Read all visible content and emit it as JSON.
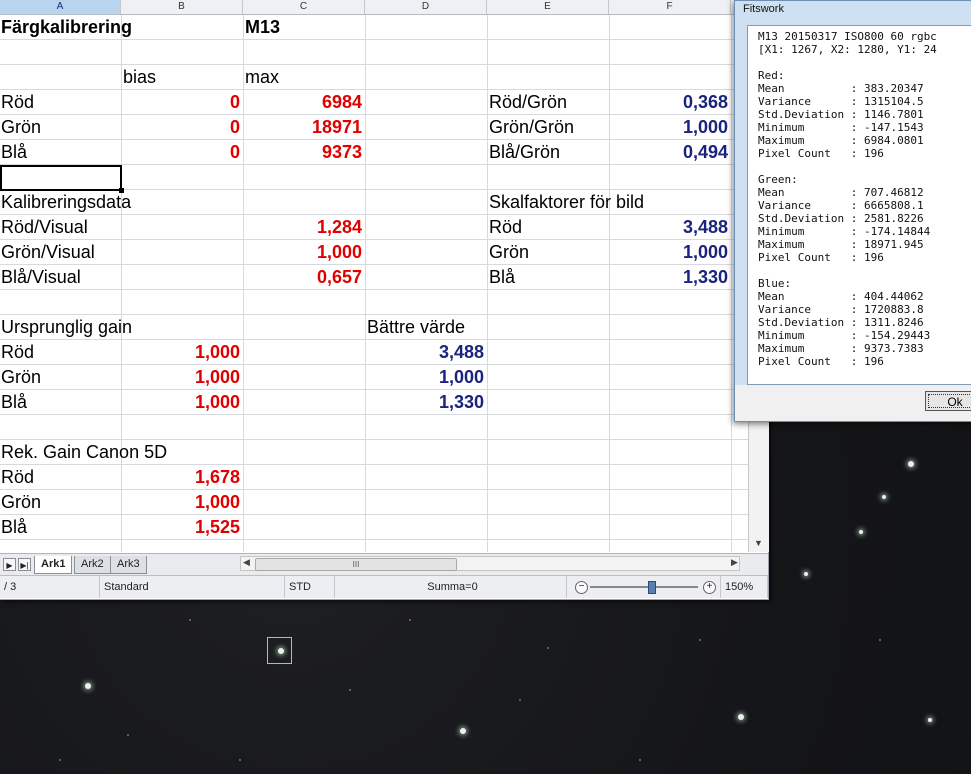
{
  "columns": [
    "A",
    "B",
    "C",
    "D",
    "E",
    "F"
  ],
  "cells": {
    "title": "Färgkalibrering",
    "object": "M13",
    "bias_hdr": "bias",
    "max_hdr": "max",
    "rows_rgb": [
      {
        "label": "Röd",
        "bias": "0",
        "max": "6984",
        "ratio_label": "Röd/Grön",
        "ratio": "0,368"
      },
      {
        "label": "Grön",
        "bias": "0",
        "max": "18971",
        "ratio_label": "Grön/Grön",
        "ratio": "1,000"
      },
      {
        "label": "Blå",
        "bias": "0",
        "max": "9373",
        "ratio_label": "Blå/Grön",
        "ratio": "0,494"
      }
    ],
    "kalib_hdr": "Kalibreringsdata",
    "skal_hdr": "Skalfaktorer för bild",
    "kalib_rows": [
      {
        "label": "Röd/Visual",
        "value": "1,284",
        "skal_label": "Röd",
        "skal": "3,488"
      },
      {
        "label": "Grön/Visual",
        "value": "1,000",
        "skal_label": "Grön",
        "skal": "1,000"
      },
      {
        "label": "Blå/Visual",
        "value": "0,657",
        "skal_label": "Blå",
        "skal": "1,330"
      }
    ],
    "gain_hdr": "Ursprunglig gain",
    "better_hdr": "Bättre värde",
    "gain_rows": [
      {
        "label": "Röd",
        "gain": "1,000",
        "better": "3,488"
      },
      {
        "label": "Grön",
        "gain": "1,000",
        "better": "1,000"
      },
      {
        "label": "Blå",
        "gain": "1,000",
        "better": "1,330"
      }
    ],
    "rek_hdr": "Rek. Gain Canon 5D",
    "rek_rows": [
      {
        "label": "Röd",
        "value": "1,678"
      },
      {
        "label": "Grön",
        "value": "1,000"
      },
      {
        "label": "Blå",
        "value": "1,525"
      }
    ]
  },
  "tabs": [
    "Ark1",
    "Ark2",
    "Ark3"
  ],
  "hscroll_label": "III",
  "status": {
    "page": "/ 3",
    "style": "Standard",
    "mode": "STD",
    "sum": "Summa=0",
    "zoom": "150%",
    "zoom_minus": "−",
    "zoom_plus": "+"
  },
  "fitswork": {
    "title": "Fitswork",
    "header_line1": "M13 20150317 ISO800 60 rgbc",
    "header_line2": "[X1: 1267, X2: 1280, Y1: 24",
    "channels": [
      {
        "name": "Red:",
        "mean": "383.20347",
        "variance": "1315104.5",
        "std": "1146.7801",
        "min": "-147.1543",
        "max": "6984.0801",
        "count": "196"
      },
      {
        "name": "Green:",
        "mean": "707.46812",
        "variance": "6665808.1",
        "std": "2581.8226",
        "min": "-174.14844",
        "max": "18971.945",
        "count": "196"
      },
      {
        "name": "Blue:",
        "mean": "404.44062",
        "variance": "1720883.8",
        "std": "1311.8246",
        "min": "-154.29443",
        "max": "9373.7383",
        "count": "196"
      }
    ],
    "labels": {
      "mean": "Mean",
      "variance": "Variance",
      "std": "Std.Deviation",
      "min": "Minimum",
      "max": "Maximum",
      "count": "Pixel Count"
    },
    "ok_label": "Ok"
  }
}
